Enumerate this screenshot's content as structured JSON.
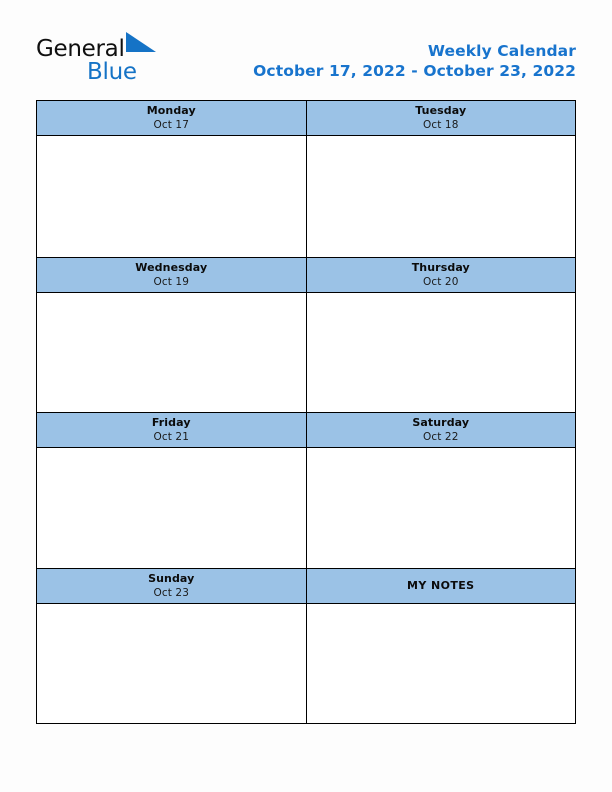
{
  "brand": {
    "name_part1": "General",
    "name_part2": "Blue",
    "triangle_color": "#1573c6",
    "text_color_dark": "#101010",
    "text_color_blue": "#1573c6"
  },
  "header": {
    "title": "Weekly Calendar",
    "date_range": "October 17, 2022 - October 23, 2022",
    "title_color": "#1874cd"
  },
  "theme": {
    "header_cell_background": "#9bc2e6",
    "border_color": "#000000",
    "body_cell_background": "#ffffff",
    "page_background": "#fdfdfd"
  },
  "calendar": {
    "rows": [
      {
        "left": {
          "day": "Monday",
          "date": "Oct 17",
          "note_cell": false
        },
        "right": {
          "day": "Tuesday",
          "date": "Oct 18",
          "note_cell": false
        }
      },
      {
        "left": {
          "day": "Wednesday",
          "date": "Oct 19",
          "note_cell": false
        },
        "right": {
          "day": "Thursday",
          "date": "Oct 20",
          "note_cell": false
        }
      },
      {
        "left": {
          "day": "Friday",
          "date": "Oct 21",
          "note_cell": false
        },
        "right": {
          "day": "Saturday",
          "date": "Oct 22",
          "note_cell": false
        }
      },
      {
        "left": {
          "day": "Sunday",
          "date": "Oct 23",
          "note_cell": false
        },
        "right": {
          "day": "MY NOTES",
          "date": "",
          "note_cell": true
        }
      }
    ]
  }
}
